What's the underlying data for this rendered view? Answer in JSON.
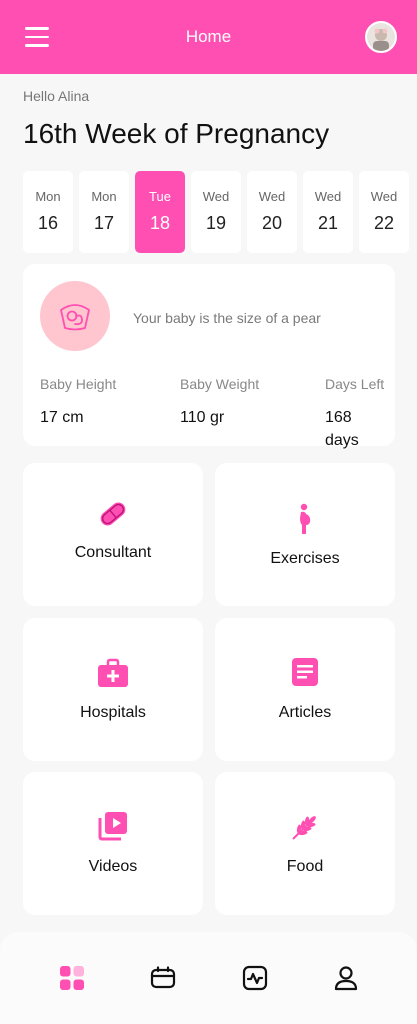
{
  "header": {
    "title": "Home",
    "accent_color": "#ff4fb3"
  },
  "greeting": "Hello Alina",
  "week_title": "16th Week of Pregnancy",
  "days": [
    {
      "name": "Mon",
      "date": "16"
    },
    {
      "name": "Mon",
      "date": "17"
    },
    {
      "name": "Tue",
      "date": "18",
      "selected": true
    },
    {
      "name": "Wed",
      "date": "19"
    },
    {
      "name": "Wed",
      "date": "20"
    },
    {
      "name": "Wed",
      "date": "21"
    },
    {
      "name": "Wed",
      "date": "22"
    }
  ],
  "baby_card": {
    "size_text": "Your baby is the size of a pear",
    "stats": [
      {
        "label": "Baby Height",
        "value": "17 cm"
      },
      {
        "label": "Baby Weight",
        "value": "110 gr"
      },
      {
        "label": "Days Left",
        "value": "168 days"
      }
    ]
  },
  "tiles": [
    {
      "label": "Consultant",
      "icon": "pill-icon"
    },
    {
      "label": "Exercises",
      "icon": "pregnant-woman-icon"
    },
    {
      "label": "Hospitals",
      "icon": "medical-kit-icon"
    },
    {
      "label": "Articles",
      "icon": "article-icon"
    },
    {
      "label": "Videos",
      "icon": "video-library-icon"
    },
    {
      "label": "Food",
      "icon": "wheat-icon"
    }
  ],
  "bottom_nav": [
    {
      "icon": "dashboard-icon",
      "active": true
    },
    {
      "icon": "calendar-icon"
    },
    {
      "icon": "activity-icon"
    },
    {
      "icon": "profile-icon"
    }
  ]
}
